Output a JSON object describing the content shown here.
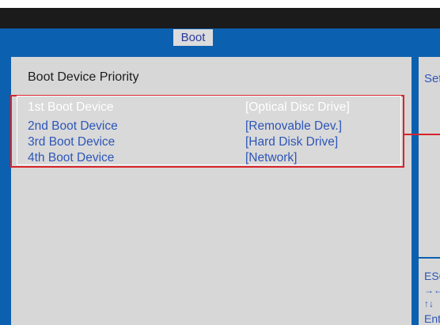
{
  "tabs": [
    {
      "label": "Boot",
      "selected": true
    }
  ],
  "section_title": "Boot Device Priority",
  "boot_devices": [
    {
      "label": "1st Boot Device",
      "value": "[Optical Disc Drive]",
      "selected": true
    },
    {
      "label": "2nd Boot Device",
      "value": "[Removable Dev.]",
      "selected": false
    },
    {
      "label": "3rd Boot Device",
      "value": "[Hard Disk Drive]",
      "selected": false
    },
    {
      "label": "4th Boot Device",
      "value": "[Network]",
      "selected": false
    }
  ],
  "help_panel": {
    "text": "Set",
    "keys": [
      "ESC",
      "→←",
      "↑↓",
      "Ent"
    ]
  },
  "colors": {
    "bios_blue": "#0c60b0",
    "panel_gray": "#d7d7d7",
    "highlight_red": "#d8232a",
    "item_blue": "#2d56b8"
  }
}
